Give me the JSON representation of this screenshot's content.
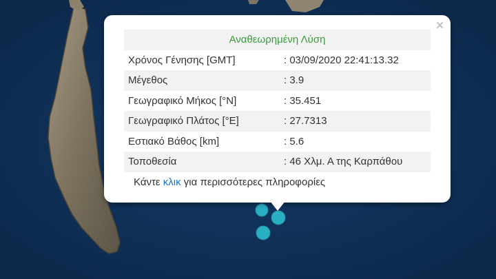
{
  "popup": {
    "title": "Αναθεωρημένη Λύση",
    "close_glyph": "×",
    "rows": [
      {
        "label": "Χρόνος Γένησης [GMT]",
        "value": ": 03/09/2020 22:41:13.32"
      },
      {
        "label": "Μέγεθος",
        "value": ": 3.9"
      },
      {
        "label": "Γεωγραφικό Μήκος [°N]",
        "value": ": 35.451"
      },
      {
        "label": "Γεωγραφικό Πλάτος [°E]",
        "value": ": 27.7313"
      },
      {
        "label": "Εστιακό Βάθος [km]",
        "value": ": 5.6"
      },
      {
        "label": "Τοποθεσία",
        "value": ": 46 Χλμ. Α της Καρπάθου"
      }
    ],
    "footer": {
      "before": "Κάντε ",
      "link": "κλικ",
      "after": " για περισσότερες πληροφορίες"
    }
  },
  "map": {
    "sea_color": "#0f2d52",
    "marker_color": "#2aaec4",
    "marker_stroke": "#1b8ea3"
  }
}
